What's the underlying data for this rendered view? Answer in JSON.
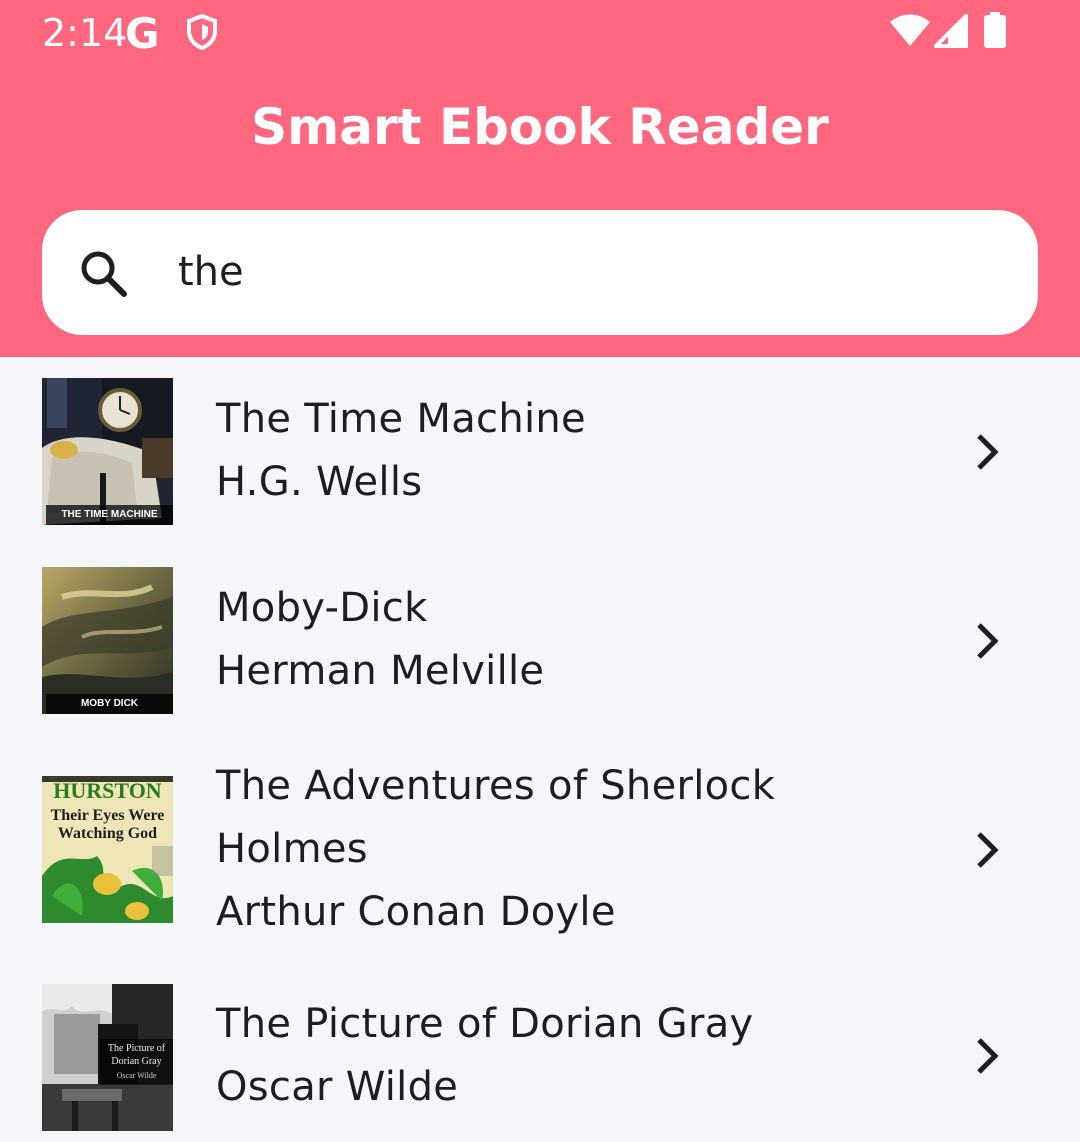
{
  "status_bar": {
    "time": "2:14",
    "g_label": "G",
    "icons": [
      "shield-icon",
      "wifi-icon",
      "signal-icon",
      "battery-icon"
    ]
  },
  "app": {
    "title": "Smart Ebook Reader",
    "accent_color": "#ff6781"
  },
  "search": {
    "value": "the",
    "icon": "search-icon"
  },
  "books": [
    {
      "title": "The Time Machine",
      "author": "H.G. Wells",
      "cover_caption": "THE TIME MACHINE"
    },
    {
      "title": "Moby-Dick",
      "author": "Herman Melville",
      "cover_caption": "MOBY DICK"
    },
    {
      "title_line1": "The Adventures of Sherlock",
      "title_line2": "Holmes",
      "author": "Arthur Conan Doyle",
      "cover_line1": "HURSTON",
      "cover_line2": "Their Eyes Were",
      "cover_line3": "Watching God"
    },
    {
      "title": "The Picture of Dorian Gray",
      "author": "Oscar Wilde",
      "cover_line1": "The Picture of",
      "cover_line2": "Dorian Gray",
      "cover_line3": "Oscar Wilde"
    }
  ]
}
